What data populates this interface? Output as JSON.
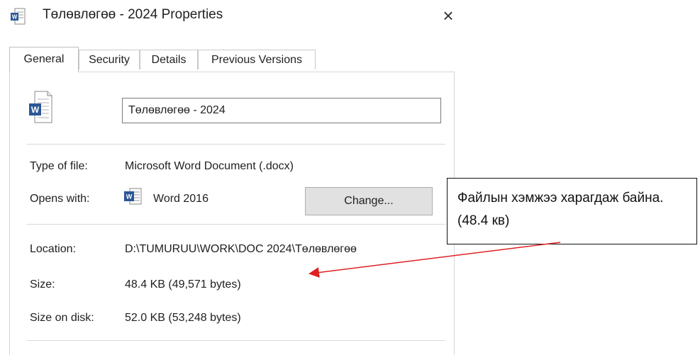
{
  "window": {
    "title": "Төлөвлөгөө - 2024 Properties",
    "close_glyph": "×",
    "title_icon": "word-doc-icon"
  },
  "tabs": [
    {
      "label": "General",
      "active": true
    },
    {
      "label": "Security",
      "active": false
    },
    {
      "label": "Details",
      "active": false
    },
    {
      "label": "Previous Versions",
      "active": false
    }
  ],
  "general": {
    "file_icon": "word-document-icon",
    "filename": "Төлөвлөгөө - 2024",
    "type_label": "Type of file:",
    "type_value": "Microsoft Word Document (.docx)",
    "opens_label": "Opens with:",
    "opens_icon": "word-app-icon",
    "opens_value": "Word 2016",
    "change_label": "Change...",
    "location_label": "Location:",
    "location_value": "D:\\TUMURUU\\WORK\\DOC 2024\\Төлөвлөгөө",
    "size_label": "Size:",
    "size_value": "48.4 KB (49,571 bytes)",
    "size_disk_label": "Size on disk:",
    "size_disk_value": "52.0 KB (53,248 bytes)"
  },
  "annotation": {
    "text": "Файлын хэмжээ харагдаж байна. (48.4 кв)",
    "arrow_color": "#e02020"
  },
  "colors": {
    "word_blue": "#2b5797",
    "button_bg": "#e1e1e1"
  }
}
